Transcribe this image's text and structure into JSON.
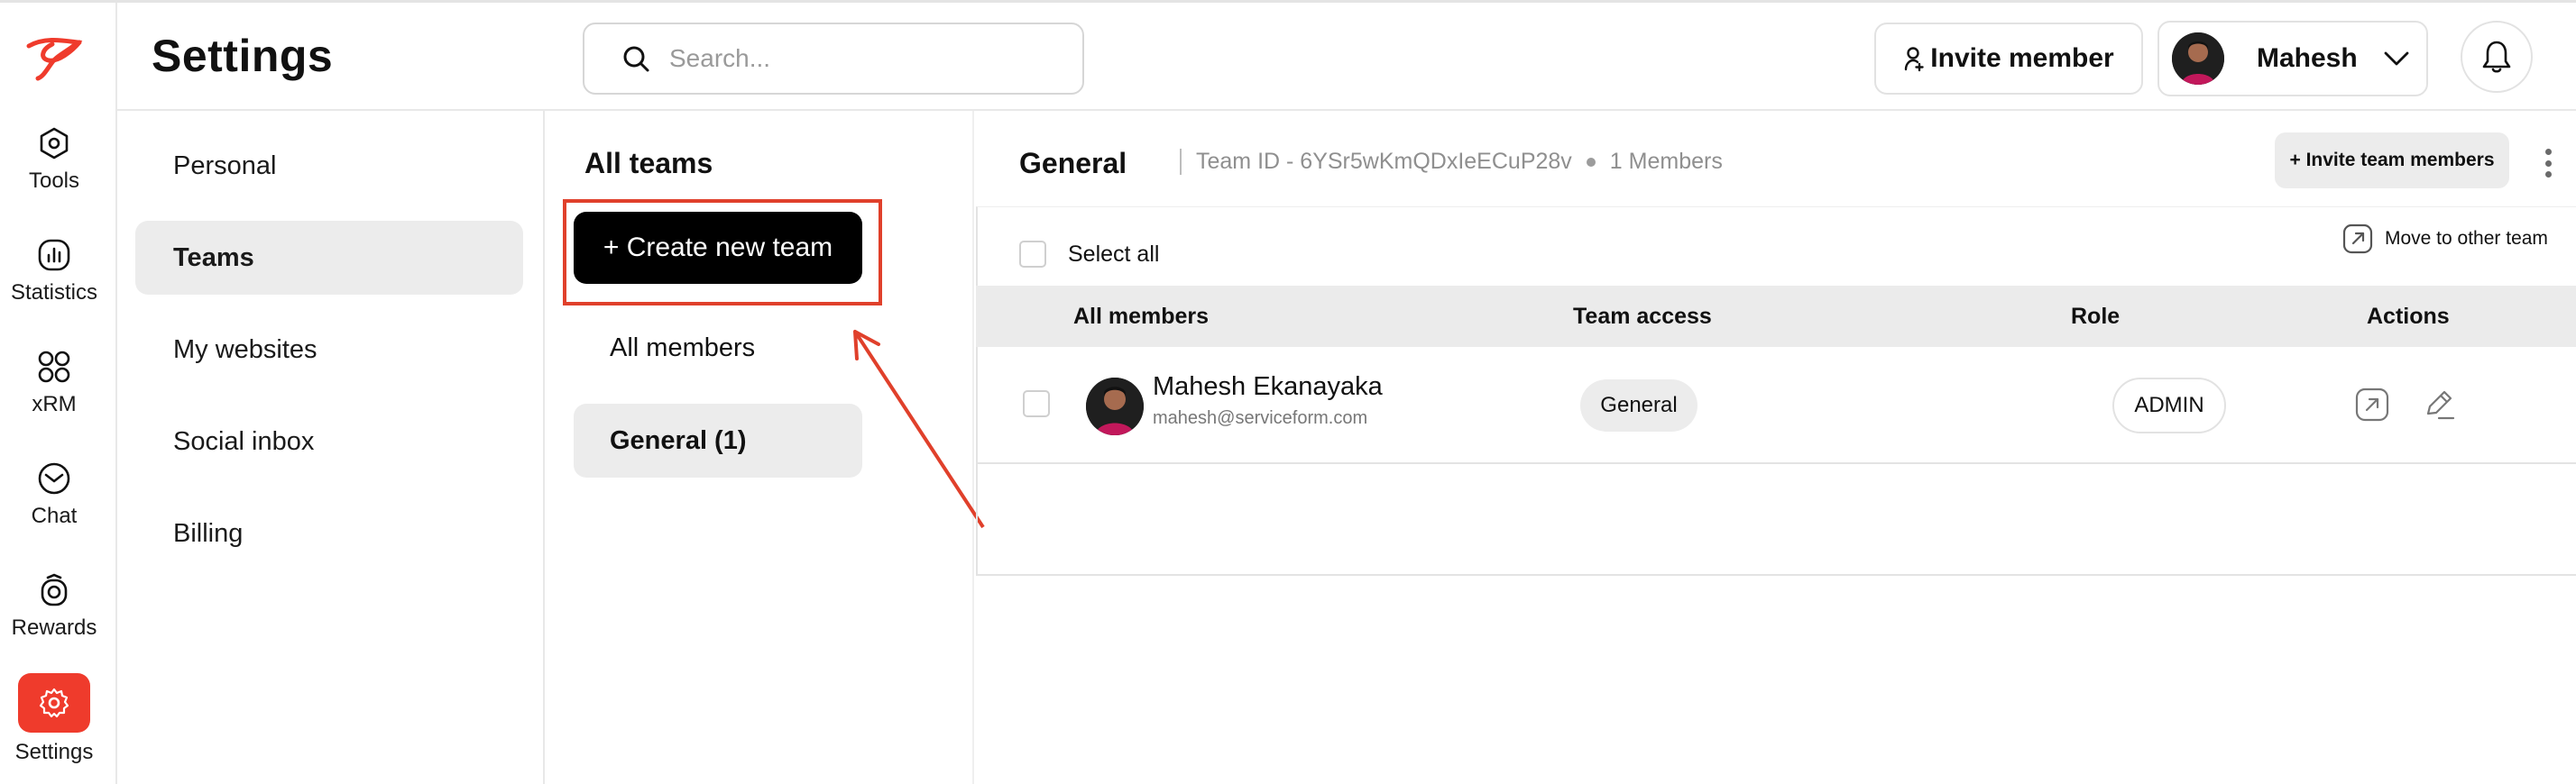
{
  "rail": {
    "items": [
      {
        "label": "Tools",
        "icon": "hexagon-icon"
      },
      {
        "label": "Statistics",
        "icon": "chart-icon"
      },
      {
        "label": "xRM",
        "icon": "grid-icon"
      },
      {
        "label": "Chat",
        "icon": "chat-icon"
      },
      {
        "label": "Rewards",
        "icon": "rewards-icon"
      },
      {
        "label": "Settings",
        "icon": "gear-icon",
        "active": true
      }
    ]
  },
  "header": {
    "title": "Settings",
    "search_placeholder": "Search...",
    "invite_label": "Invite member",
    "user_name": "Mahesh"
  },
  "subnav": {
    "items": [
      {
        "label": "Personal"
      },
      {
        "label": "Teams",
        "active": true
      },
      {
        "label": "My websites"
      },
      {
        "label": "Social inbox"
      },
      {
        "label": "Billing"
      }
    ]
  },
  "teams": {
    "title": "All teams",
    "create_label": "+ Create new team",
    "items": [
      {
        "label": "All members"
      },
      {
        "label": "General (1)",
        "active": true
      }
    ]
  },
  "main": {
    "team_name": "General",
    "team_id": "Team ID - 6YSr5wKmQDxIeECuP28v",
    "member_count": "1 Members",
    "invite_team_label": "+ Invite team members",
    "select_all_label": "Select all",
    "move_label": "Move to other team",
    "columns": [
      "All members",
      "Team access",
      "Role",
      "Actions"
    ],
    "rows": [
      {
        "name": "Mahesh Ekanayaka",
        "email": "mahesh@serviceform.com",
        "team_access": "General",
        "role": "ADMIN"
      }
    ]
  },
  "colors": {
    "brand_red": "#ef3b2c",
    "annotation_red": "#e0402b",
    "active_bg": "#ececec"
  }
}
